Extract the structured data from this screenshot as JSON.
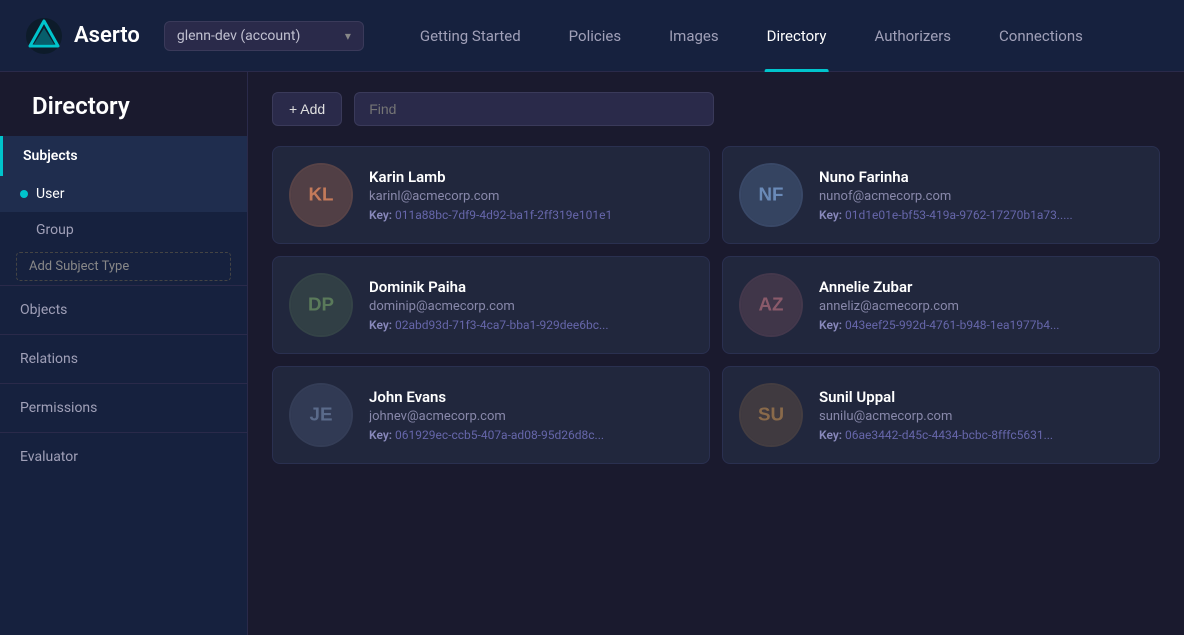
{
  "app": {
    "name": "Aserto"
  },
  "topnav": {
    "account": "glenn-dev (account)",
    "links": [
      {
        "id": "getting-started",
        "label": "Getting Started",
        "active": false
      },
      {
        "id": "policies",
        "label": "Policies",
        "active": false
      },
      {
        "id": "images",
        "label": "Images",
        "active": false
      },
      {
        "id": "directory",
        "label": "Directory",
        "active": true
      },
      {
        "id": "authorizers",
        "label": "Authorizers",
        "active": false
      },
      {
        "id": "connections",
        "label": "Connections",
        "active": false
      }
    ]
  },
  "page": {
    "title": "Directory"
  },
  "sidebar": {
    "subjects_label": "Subjects",
    "user_label": "User",
    "group_label": "Group",
    "add_subject_type_label": "Add Subject Type",
    "objects_label": "Objects",
    "relations_label": "Relations",
    "permissions_label": "Permissions",
    "evaluator_label": "Evaluator"
  },
  "toolbar": {
    "add_label": "+ Add",
    "find_placeholder": "Find"
  },
  "users": [
    {
      "id": "karin-lamb",
      "name": "Karin Lamb",
      "email": "karinl@acmecorp.com",
      "key": "011a88bc-7df9-4d92-ba1f-2ff319e101e1",
      "avatar_initials": "KL",
      "avatar_color": "#c47a5a"
    },
    {
      "id": "nuno-farinha",
      "name": "Nuno Farinha",
      "email": "nunof@acmecorp.com",
      "key": "01d1e01e-bf53-419a-9762-17270b1a73...",
      "avatar_initials": "NF",
      "avatar_color": "#6a8ab8"
    },
    {
      "id": "dominik-paiha",
      "name": "Dominik Paiha",
      "email": "dominip@acmecorp.com",
      "key": "02abd93d-71f3-4ca7-bba1-929dee6bc...",
      "avatar_initials": "DP",
      "avatar_color": "#5a7a5a"
    },
    {
      "id": "annelie-zubar",
      "name": "Annelie Zubar",
      "email": "anneliz@acmecorp.com",
      "key": "043eef25-992d-4761-b948-1ea1977b4...",
      "avatar_initials": "AZ",
      "avatar_color": "#8a5a6a"
    },
    {
      "id": "john-evans",
      "name": "John Evans",
      "email": "johnev@acmecorp.com",
      "key": "061929ec-ccb5-407a-ad08-95d26d8c...",
      "avatar_initials": "JE",
      "avatar_color": "#5a6a8a"
    },
    {
      "id": "sunil-uppal",
      "name": "Sunil Uppal",
      "email": "sunilu@acmecorp.com",
      "key": "06ae3442-d45c-4434-bcbc-8fffc5631...",
      "avatar_initials": "SU",
      "avatar_color": "#8a6a4a"
    }
  ]
}
